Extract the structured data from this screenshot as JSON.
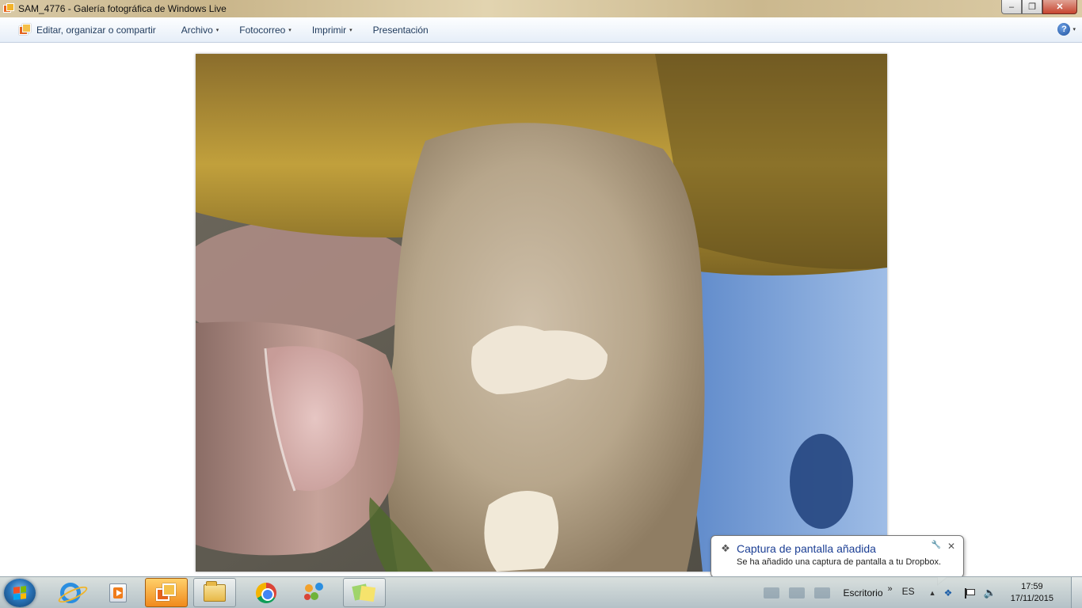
{
  "window": {
    "title": "SAM_4776 - Galería fotográfica de Windows Live",
    "min_glyph": "‒",
    "max_glyph": "❐",
    "close_glyph": "✕"
  },
  "menubar": {
    "edit_organize_share": "Editar, organizar o compartir",
    "file": "Archivo",
    "photo_email": "Fotocorreo",
    "print": "Imprimir",
    "slideshow": "Presentación",
    "help_glyph": "?",
    "dropdown_glyph": "▾"
  },
  "photo": {
    "description": "Close-up of a mushroom stem held by a thumb"
  },
  "notification": {
    "title": "Captura de pantalla añadida",
    "body": "Se ha añadido una captura de pantalla a tu Dropbox.",
    "dropbox_glyph": "❖",
    "settings_glyph": "🔧",
    "close_glyph": "✕"
  },
  "taskbar": {
    "desktop_label": "Escritorio",
    "overflow_glyph": "»",
    "language": "ES",
    "tray_up_glyph": "▲",
    "speaker_glyph": "🔈",
    "time": "17:59",
    "date": "17/11/2015",
    "dropbox_glyph": "❖"
  },
  "colors": {
    "accent_title": "#1c3f94",
    "menu_text": "#1e395b",
    "active_taskbar": "#f08a1c"
  }
}
